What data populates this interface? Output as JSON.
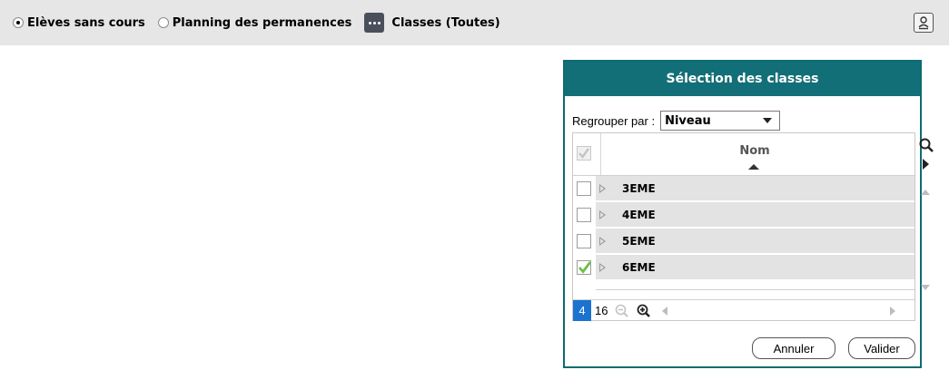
{
  "toolbar": {
    "options": [
      {
        "label": "Elèves sans cours",
        "selected": true
      },
      {
        "label": "Planning des permanences",
        "selected": false
      }
    ],
    "classes_label": "Classes (Toutes)",
    "more_icon": "ellipsis-icon",
    "user_icon": "user-badge-icon"
  },
  "dialog": {
    "title": "Sélection des classes",
    "group_by_label": "Regrouper par :",
    "group_by_value": "Niveau",
    "column_header": "Nom",
    "rows": [
      {
        "label": "3EME",
        "checked": false
      },
      {
        "label": "4EME",
        "checked": false
      },
      {
        "label": "5EME",
        "checked": false
      },
      {
        "label": "6EME",
        "checked": true
      }
    ],
    "footer": {
      "count_active": "4",
      "count_total": "16"
    },
    "cancel_label": "Annuler",
    "ok_label": "Valider"
  },
  "colors": {
    "header_teal": "#136f77",
    "toolbar_bg": "#e6e6e6",
    "active_blue": "#1a73cf",
    "check_green": "#6cc04a"
  }
}
